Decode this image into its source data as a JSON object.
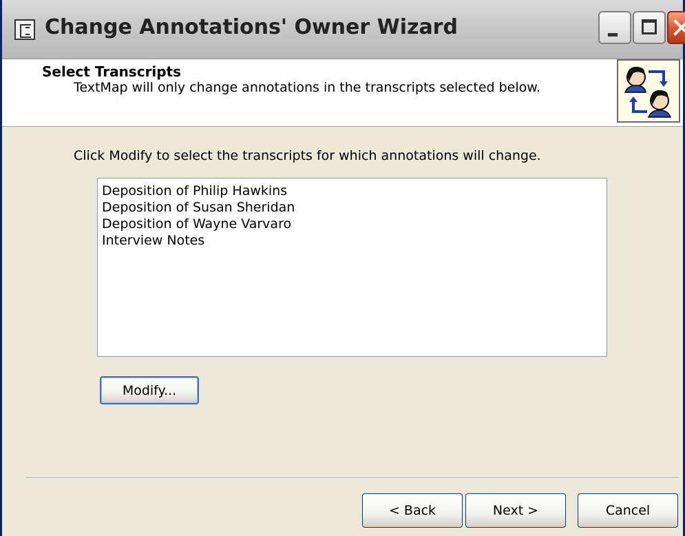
{
  "window": {
    "title": "Change Annotations' Owner Wizard",
    "controls": {
      "minimize_icon": "minimize-icon",
      "maximize_icon": "maximize-icon",
      "close_icon": "close-icon"
    }
  },
  "header": {
    "title": "Select Transcripts",
    "subtitle": "TextMap will only change annotations in the transcripts selected below.",
    "icon": "change-owner-icon"
  },
  "content": {
    "instruction": "Click Modify to select the transcripts for which annotations will change.",
    "transcripts": [
      "Deposition of Philip Hawkins",
      "Deposition of Susan Sheridan",
      "Deposition of Wayne Varvaro",
      "Interview Notes"
    ],
    "modify_label": "Modify..."
  },
  "footer": {
    "back_label": "< Back",
    "next_label": "Next >",
    "cancel_label": "Cancel"
  },
  "colors": {
    "window_bg": "#ece9d8",
    "header_bg": "#ffffff",
    "close_button": "#d8532d",
    "list_border": "#7f9db9"
  }
}
